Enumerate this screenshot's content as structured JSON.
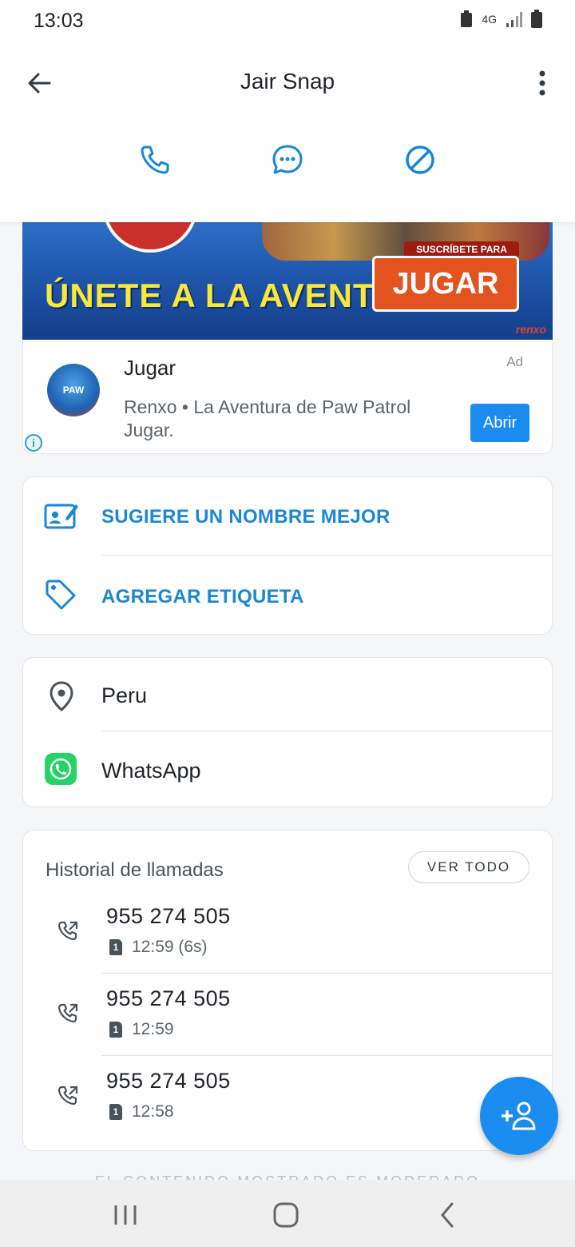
{
  "status_bar": {
    "time": "13:03",
    "network": "4G"
  },
  "header": {
    "title": "Jair Snap"
  },
  "ad": {
    "banner_text": "ÚNETE A LA AVENTURA",
    "banner_sub": "SUSCRÍBETE PARA",
    "banner_cta": "JUGAR",
    "banner_brand": "renxo",
    "title": "Jugar",
    "description": "Renxo • La Aventura de Paw Patrol Jugar.",
    "tag": "Ad",
    "open_button": "Abrir"
  },
  "actions": {
    "suggest_name": "SUGIERE UN NOMBRE MEJOR",
    "add_tag": "AGREGAR ETIQUETA"
  },
  "info": {
    "location": "Peru",
    "app": "WhatsApp"
  },
  "history": {
    "title": "Historial de llamadas",
    "see_all": "VER TODO",
    "calls": [
      {
        "number": "955 274 505",
        "sim": "1",
        "time": "12:59 (6s)"
      },
      {
        "number": "955 274 505",
        "sim": "1",
        "time": "12:59"
      },
      {
        "number": "955 274 505",
        "sim": "1",
        "time": "12:58"
      }
    ]
  },
  "footer": {
    "text": "EL CONTENIDO MOSTRADO ES MODERADO"
  },
  "colors": {
    "accent": "#1a8cf0",
    "link": "#1a86d6",
    "whatsapp": "#25d366"
  },
  "icons": [
    "back-arrow-icon",
    "more-icon",
    "phone-icon",
    "message-icon",
    "block-icon",
    "contact-edit-icon",
    "tag-icon",
    "location-pin-icon",
    "whatsapp-icon",
    "outgoing-call-icon",
    "sim-icon",
    "add-contact-icon"
  ]
}
